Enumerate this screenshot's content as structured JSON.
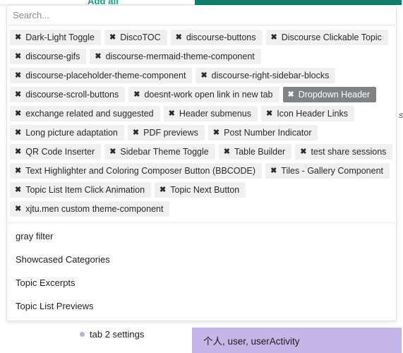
{
  "top": {
    "add_all_label": "Add all",
    "teal_bar_color": "#0f7f69"
  },
  "search": {
    "placeholder": "Search...",
    "value": ""
  },
  "chips": {
    "close_icon": "✖",
    "selected_label": "Dropdown Header",
    "items": [
      {
        "label": "Dark-Light Toggle",
        "selected": false
      },
      {
        "label": "DiscoTOC",
        "selected": false
      },
      {
        "label": "discourse-buttons",
        "selected": false
      },
      {
        "label": "Discourse Clickable Topic",
        "selected": false
      },
      {
        "label": "discourse-gifs",
        "selected": false
      },
      {
        "label": "discourse-mermaid-theme-component",
        "selected": false
      },
      {
        "label": "discourse-placeholder-theme-component",
        "selected": false
      },
      {
        "label": "discourse-right-sidebar-blocks",
        "selected": false
      },
      {
        "label": "discourse-scroll-buttons",
        "selected": false
      },
      {
        "label": "doesnt-work open link in new tab",
        "selected": false
      },
      {
        "label": "Dropdown Header",
        "selected": true
      },
      {
        "label": "exchange related and suggested",
        "selected": false
      },
      {
        "label": "Header submenus",
        "selected": false
      },
      {
        "label": "Icon Header Links",
        "selected": false
      },
      {
        "label": "Long picture adaptation",
        "selected": false
      },
      {
        "label": "PDF previews",
        "selected": false
      },
      {
        "label": "Post Number Indicator",
        "selected": false
      },
      {
        "label": "QR Code Inserter",
        "selected": false
      },
      {
        "label": "Sidebar Theme Toggle",
        "selected": false
      },
      {
        "label": "Table Builder",
        "selected": false
      },
      {
        "label": "test share sessions",
        "selected": false
      },
      {
        "label": "Text Highlighter and Coloring Composer Button (BBCODE)",
        "selected": false
      },
      {
        "label": "Tiles - Gallery Component",
        "selected": false
      },
      {
        "label": "Topic List Item Click Animation",
        "selected": false
      },
      {
        "label": "Topic Next Button",
        "selected": false
      },
      {
        "label": "xjtu.men custom theme-component",
        "selected": false
      }
    ]
  },
  "options": {
    "items": [
      {
        "label": "gray filter"
      },
      {
        "label": "Showcased Categories"
      },
      {
        "label": "Topic Excerpts"
      },
      {
        "label": "Topic List Previews"
      }
    ]
  },
  "edge": {
    "cut_text": "se"
  },
  "bottom": {
    "tab_label": "tab 2 settings",
    "purple_box_text": "个人, user, userActivity",
    "purple_box_color": "#c4b7e8"
  }
}
